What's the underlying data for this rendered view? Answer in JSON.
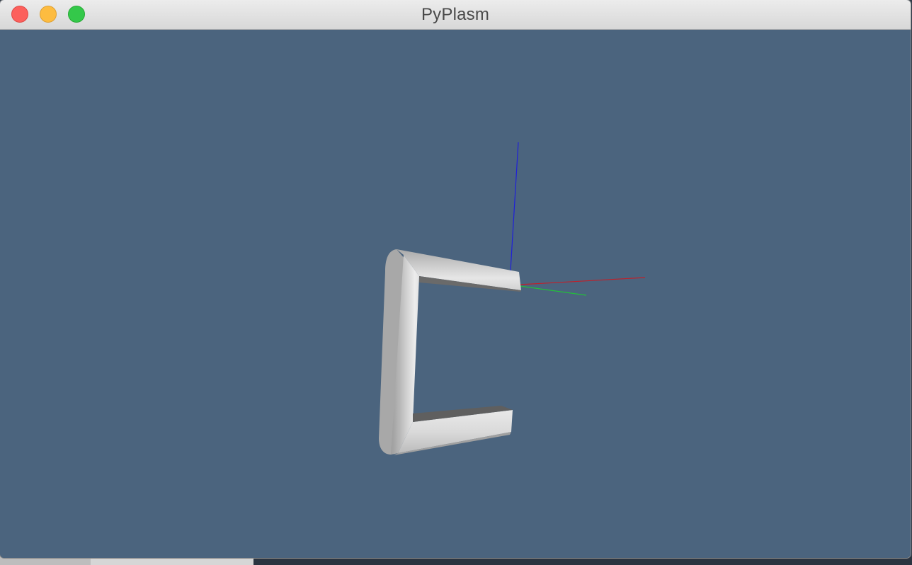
{
  "window": {
    "title": "PyPlasm"
  },
  "controls": {
    "close": "close-button",
    "minimize": "minimize-button",
    "zoom": "zoom-button"
  },
  "viewport": {
    "background_color": "#4b647e",
    "axes": {
      "x_color": "#c0202a",
      "y_color": "#22c03a",
      "z_color": "#1f20d8"
    },
    "model_color": "#d9d9d9"
  }
}
